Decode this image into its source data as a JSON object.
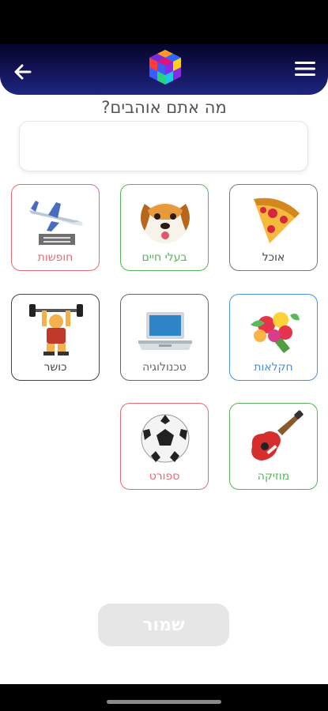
{
  "header": {
    "back_icon": "arrow-left-icon",
    "menu_icon": "hamburger-menu-icon",
    "logo": "colorful-cube-logo"
  },
  "question": "מה אתם אוהבים?",
  "answer_input": {
    "value": "",
    "placeholder": ""
  },
  "categories": [
    {
      "label": "אוכל",
      "icon": "pizza-icon",
      "color": "#444444"
    },
    {
      "label": "בעלי חיים",
      "icon": "dog-face-icon",
      "color": "#58b25b"
    },
    {
      "label": "חופשות",
      "icon": "airplane-icon",
      "color": "#e56a72"
    },
    {
      "label": "חקלאות",
      "icon": "flower-bouquet-icon",
      "color": "#4a8fe0"
    },
    {
      "label": "טכנולוגיה",
      "icon": "laptop-icon",
      "color": "#666666"
    },
    {
      "label": "כושר",
      "icon": "weightlifter-icon",
      "color": "#444444"
    },
    {
      "label": "מוזיקה",
      "icon": "guitar-icon",
      "color": "#58b25b"
    },
    {
      "label": "ספורט",
      "icon": "soccer-ball-icon",
      "color": "#e56a72"
    }
  ],
  "save_button": {
    "label": "שמור"
  }
}
